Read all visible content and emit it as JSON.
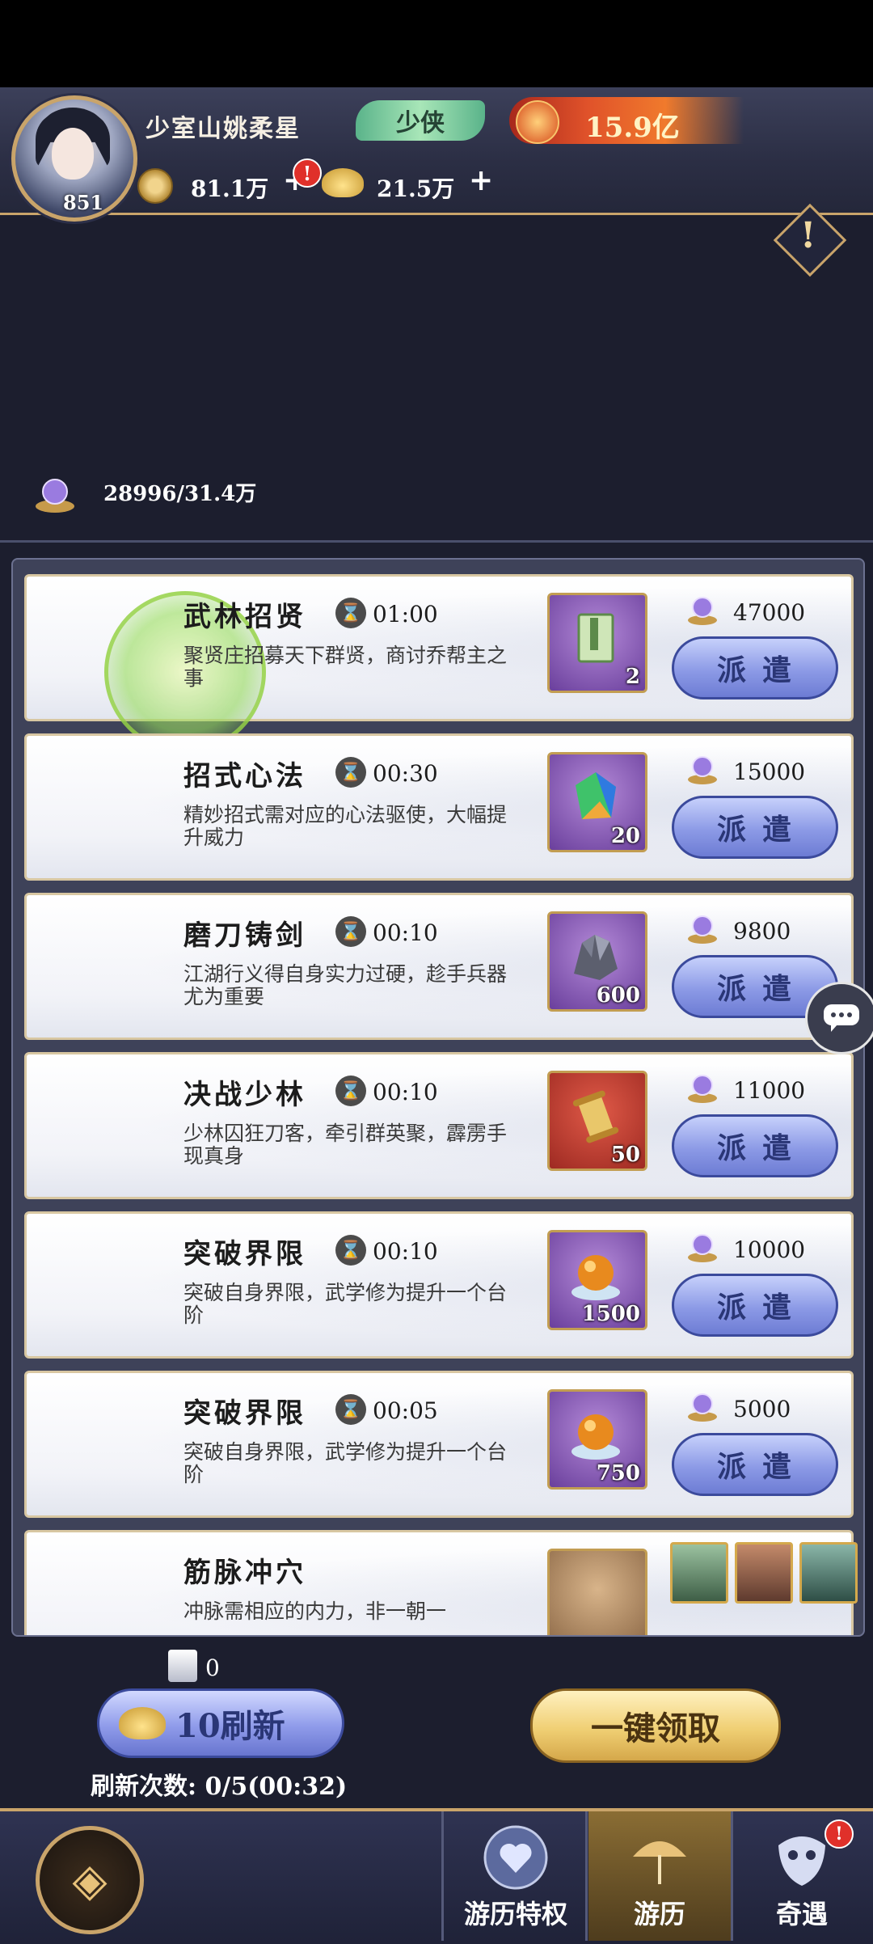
{
  "player": {
    "name": "少室山姚柔星",
    "level": "851",
    "rank": "少侠",
    "power": "15.9亿",
    "coins": "81.1万",
    "ingots": "21.5万",
    "alert": "!"
  },
  "stamina": "28996/31.4万",
  "missions": [
    {
      "title": "武林招贤",
      "time": "01:00",
      "desc": "聚贤庄招募天下群贤，商讨乔帮主之事",
      "reward_qty": "2",
      "cost": "47000",
      "button": "派遣"
    },
    {
      "title": "招式心法",
      "time": "00:30",
      "desc": "精妙招式需对应的心法驱使，大幅提升威力",
      "reward_qty": "20",
      "cost": "15000",
      "button": "派遣"
    },
    {
      "title": "磨刀铸剑",
      "time": "00:10",
      "desc": "江湖行义得自身实力过硬，趁手兵器尤为重要",
      "reward_qty": "600",
      "cost": "9800",
      "button": "派遣"
    },
    {
      "title": "决战少林",
      "time": "00:10",
      "desc": "少林囚狂刀客，牵引群英聚，霹雳手现真身",
      "reward_qty": "50",
      "cost": "11000",
      "button": "派遣"
    },
    {
      "title": "突破界限",
      "time": "00:10",
      "desc": "突破自身界限，武学修为提升一个台阶",
      "reward_qty": "1500",
      "cost": "10000",
      "button": "派遣"
    },
    {
      "title": "突破界限",
      "time": "00:05",
      "desc": "突破自身界限，武学修为提升一个台阶",
      "reward_qty": "750",
      "cost": "5000",
      "button": "派遣"
    },
    {
      "title": "筋脉冲穴",
      "time": "",
      "desc": "冲脉需相应的内力，非一朝一",
      "reward_qty": "",
      "cost": "",
      "button": ""
    }
  ],
  "tickets": "0",
  "refresh": {
    "label": "10刷新",
    "count": "刷新次数: 0/5(00:32)"
  },
  "claim_all": "一键领取",
  "nav": {
    "privilege": "游历特权",
    "travel": "游历",
    "encounter": "奇遇",
    "alert": "!"
  },
  "colors": {
    "accent_gold": "#c9a46a",
    "button_blue": "#8c9ae6",
    "alert_red": "#e0302a"
  }
}
